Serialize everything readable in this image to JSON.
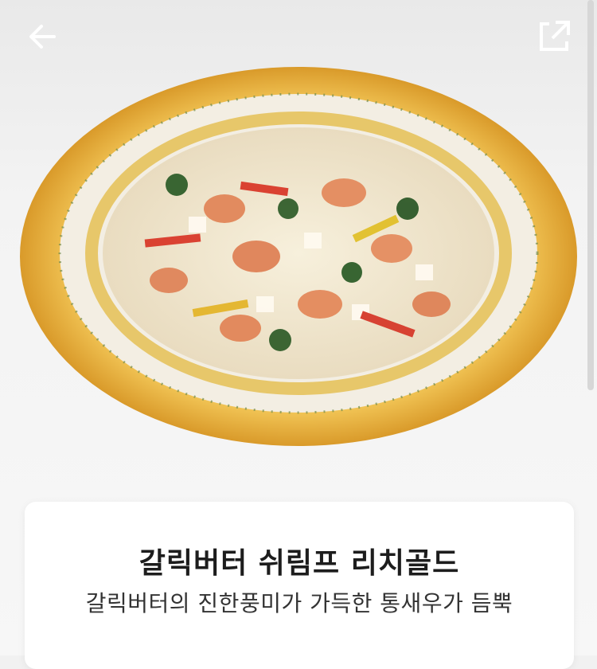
{
  "header": {
    "back_icon": "arrow-left-icon",
    "share_icon": "share-external-icon"
  },
  "product": {
    "name": "갈릭버터 쉬림프 리치골드",
    "description": "갈릭버터의 진한풍미가 가득한 통새우가 듬뿍"
  },
  "colors": {
    "crust": "#e8b33c",
    "card_bg": "#ffffff",
    "page_bg": "#f1f1f1",
    "title_text": "#1d1d1d"
  }
}
